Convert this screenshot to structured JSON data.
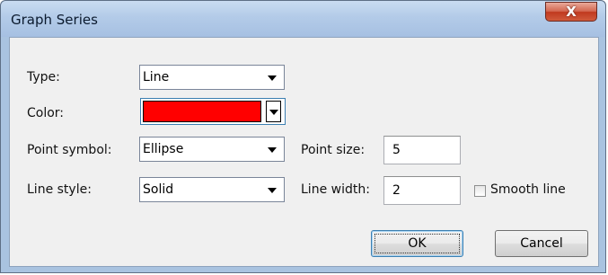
{
  "window": {
    "title": "Graph Series",
    "close_glyph": "X"
  },
  "form": {
    "type_label": "Type:",
    "type_value": "Line",
    "color_label": "Color:",
    "color_value": "#ff0000",
    "point_symbol_label": "Point symbol:",
    "point_symbol_value": "Ellipse",
    "point_size_label": "Point size:",
    "point_size_value": "5",
    "line_style_label": "Line style:",
    "line_style_value": "Solid",
    "line_width_label": "Line width:",
    "line_width_value": "2",
    "smooth_line_label": "Smooth line",
    "smooth_line_checked": false
  },
  "buttons": {
    "ok_label": "OK",
    "cancel_label": "Cancel"
  },
  "icons": {
    "close": "close-icon",
    "dropdown": "chevron-down-icon"
  }
}
